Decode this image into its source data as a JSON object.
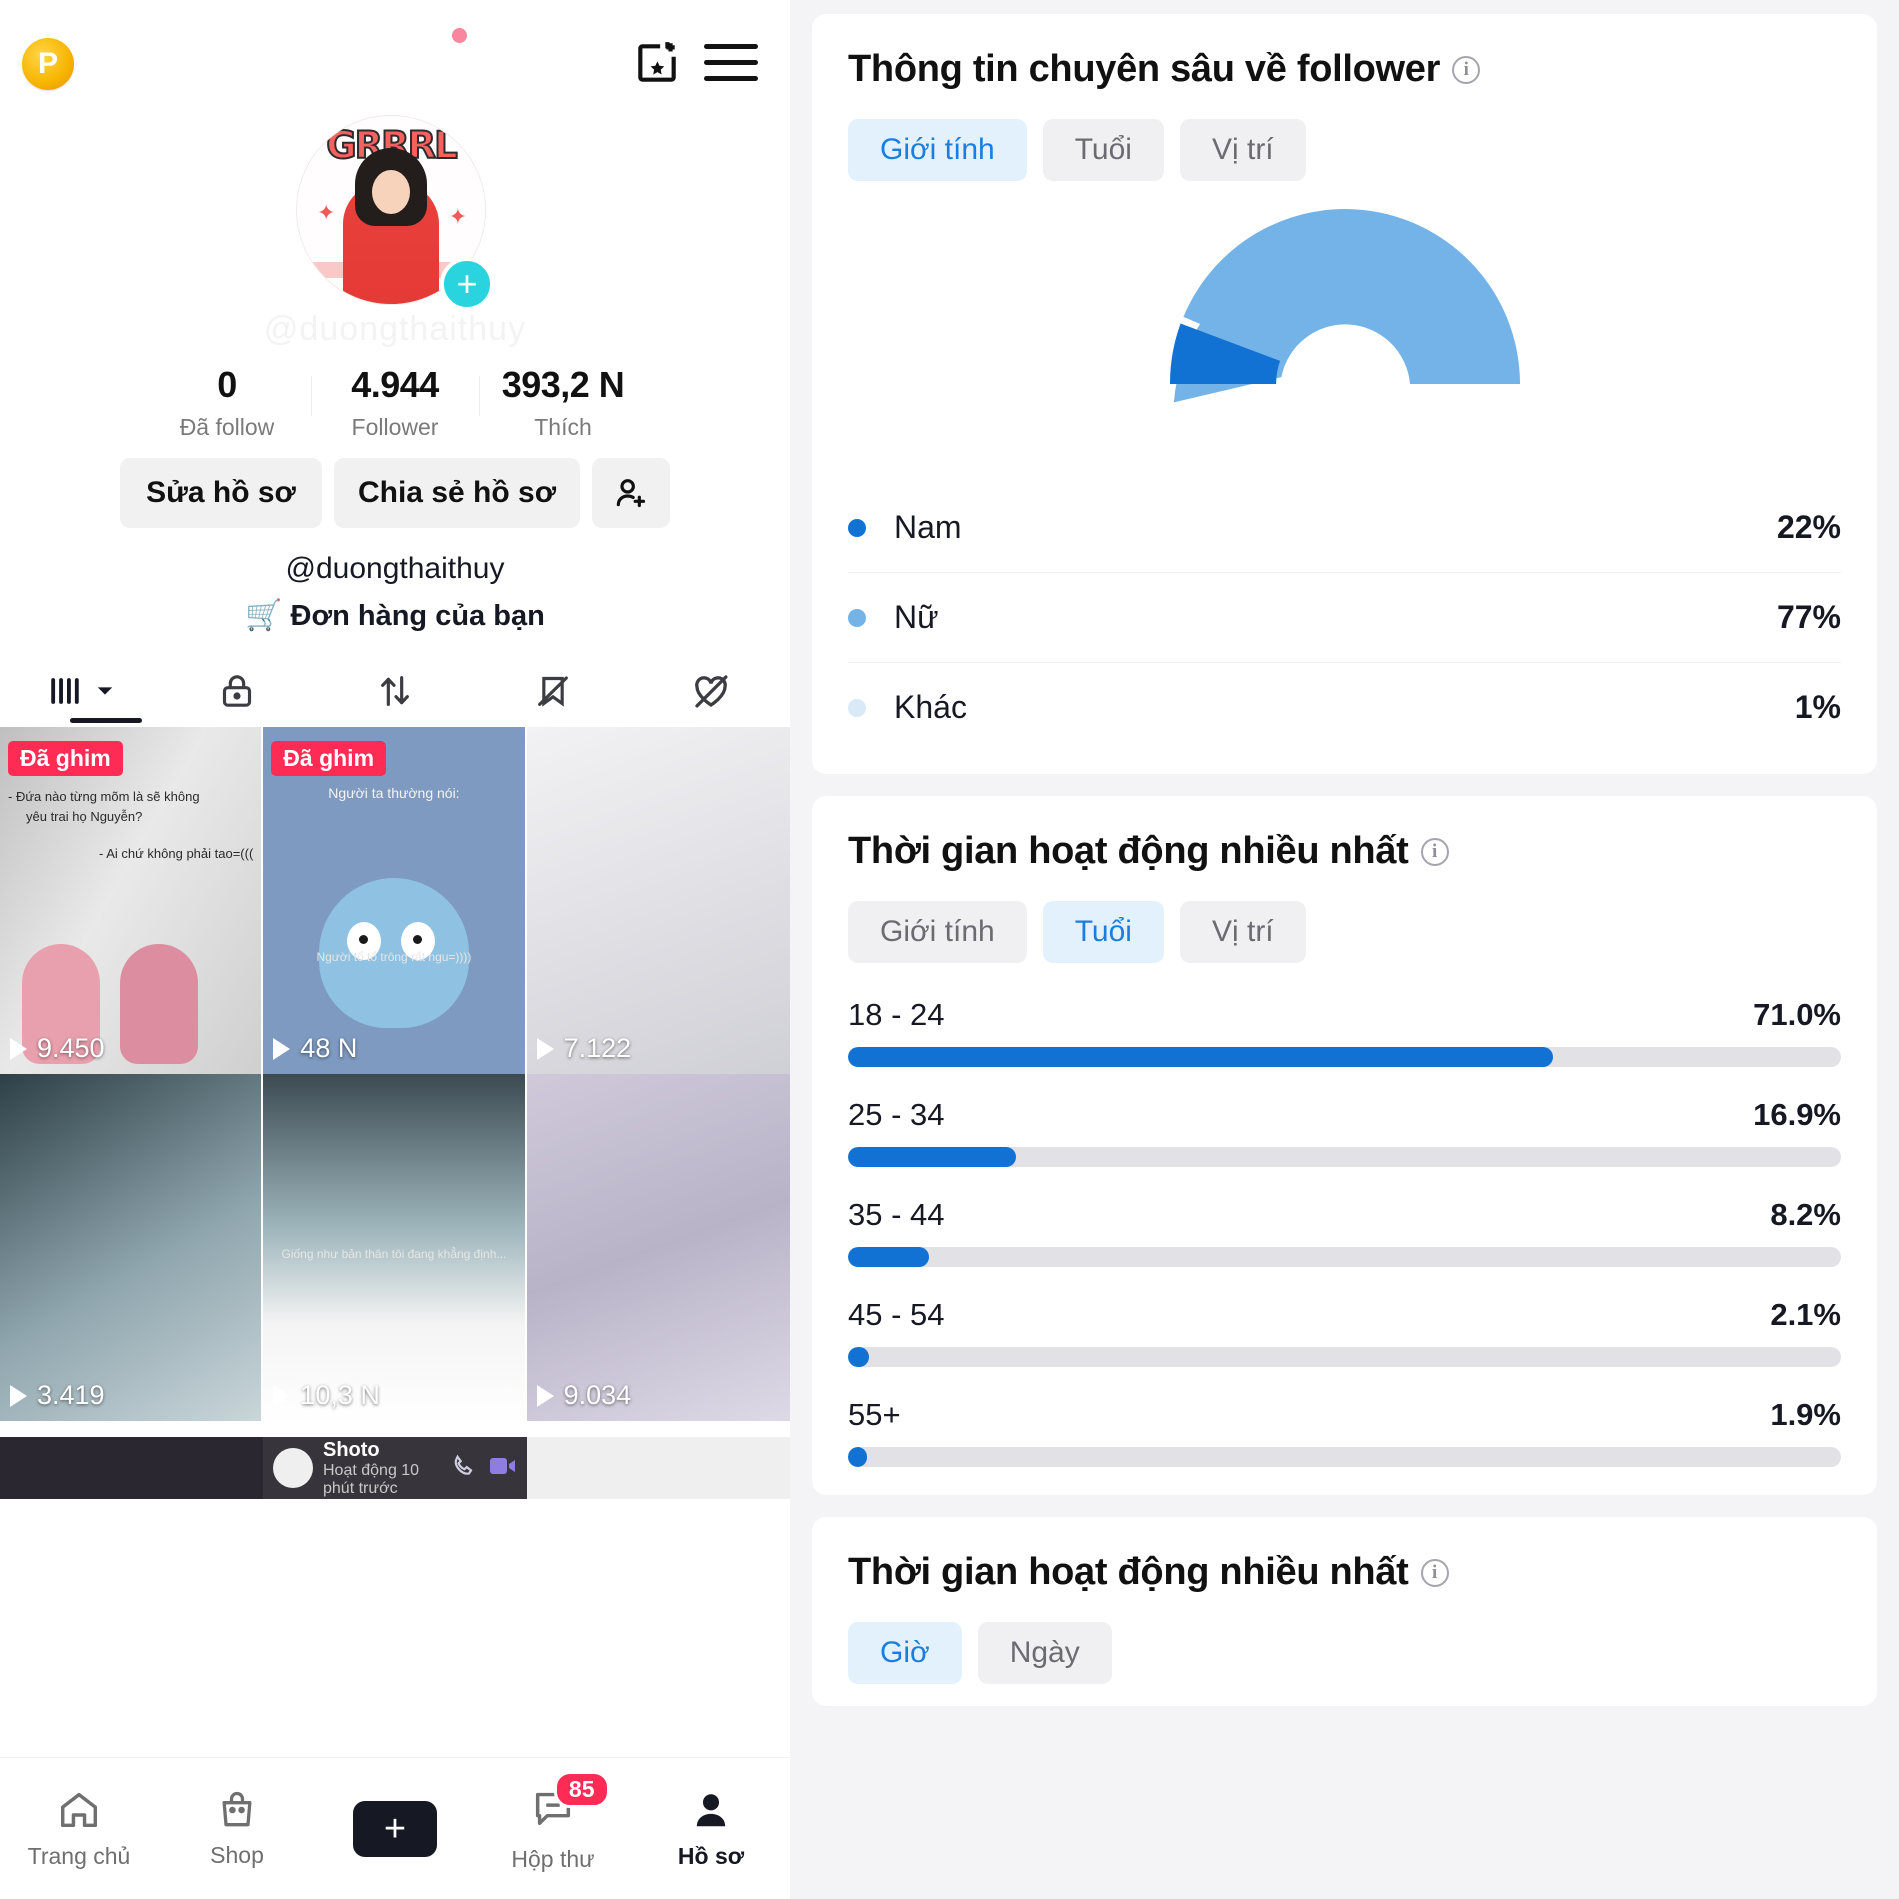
{
  "left_panel": {
    "topbar": {
      "coin_badge": "P",
      "faded_title": "",
      "calendar_icon": "calendar-star-icon",
      "menu_icon": "hamburger-menu-icon"
    },
    "profile": {
      "avatar_word": "GRRRL",
      "watermark_handle": "@duongthaithuy",
      "handle": "@duongthaithuy",
      "orders_label": "Đơn hàng của bạn",
      "plus_badge": "+"
    },
    "stats": [
      {
        "value": "0",
        "label": "Đã follow"
      },
      {
        "value": "4.944",
        "label": "Follower"
      },
      {
        "value": "393,2 N",
        "label": "Thích"
      }
    ],
    "actions": {
      "edit_label": "Sửa hồ sơ",
      "share_label": "Chia sẻ hồ sơ",
      "add_user_icon": "add-person-icon"
    },
    "content_tabs": [
      {
        "icon": "grid-posts-icon",
        "active": true
      },
      {
        "icon": "lock-private-icon",
        "active": false
      },
      {
        "icon": "repost-icon",
        "active": false
      },
      {
        "icon": "bookmark-hidden-icon",
        "active": false
      },
      {
        "icon": "heart-hidden-icon",
        "active": false
      }
    ],
    "videos": [
      {
        "pin": "Đã ghim",
        "views": "9.450",
        "caption_1": "- Đứa nào từng mõm là sẽ không",
        "caption_2": "yêu trai họ Nguyễn?",
        "caption_3": "- Ai chứ không phải tao=((("
      },
      {
        "pin": "Đã ghim",
        "views": "48 N",
        "caption_1": "Người ta thường nói:",
        "caption_2": "Người tổ tổ trông rất ngu=))))"
      },
      {
        "pin": "",
        "views": "7.122"
      },
      {
        "pin": "",
        "views": "3.419"
      },
      {
        "pin": "",
        "views": "10,3 N",
        "caption_1": "Giống như bản thân tôi đang khẳng định..."
      },
      {
        "pin": "",
        "views": "9.034"
      }
    ],
    "chat_overlay": {
      "name": "Shoto",
      "status": "Hoạt động 10 phút trước",
      "call_icon": "phone-icon",
      "video_icon": "video-camera-icon"
    },
    "bottom_nav": [
      {
        "label": "Trang chủ",
        "icon": "home-icon",
        "active": false,
        "badge": ""
      },
      {
        "label": "Shop",
        "icon": "shopping-bag-icon",
        "active": false,
        "badge": ""
      },
      {
        "label": "",
        "icon": "create-plus-icon",
        "active": false,
        "badge": ""
      },
      {
        "label": "Hộp thư",
        "icon": "inbox-message-icon",
        "active": false,
        "badge": "85"
      },
      {
        "label": "Hồ sơ",
        "icon": "person-profile-icon",
        "active": true,
        "badge": ""
      }
    ]
  },
  "right_panel": {
    "follower_insights": {
      "title": "Thông tin chuyên sâu về follower",
      "info_icon": "info-icon",
      "tabs": [
        {
          "label": "Giới tính",
          "active": true
        },
        {
          "label": "Tuổi",
          "active": false
        },
        {
          "label": "Vị trí",
          "active": false
        }
      ],
      "legend": [
        {
          "name": "Nam",
          "value": "22%",
          "color": "#1172d4"
        },
        {
          "name": "Nữ",
          "value": "77%",
          "color": "#74b3e8"
        },
        {
          "name": "Khác",
          "value": "1%",
          "color": "#d9e9f8"
        }
      ]
    },
    "most_active_age": {
      "title": "Thời gian hoạt động nhiều nhất",
      "info_icon": "info-icon",
      "tabs": [
        {
          "label": "Giới tính",
          "active": false
        },
        {
          "label": "Tuổi",
          "active": true
        },
        {
          "label": "Vị trí",
          "active": false
        }
      ],
      "rows": [
        {
          "label": "18 - 24",
          "value": "71.0%",
          "pct": 71.0
        },
        {
          "label": "25 - 34",
          "value": "16.9%",
          "pct": 16.9
        },
        {
          "label": "35 - 44",
          "value": "8.2%",
          "pct": 8.2
        },
        {
          "label": "45 - 54",
          "value": "2.1%",
          "pct": 2.1
        },
        {
          "label": "55+",
          "value": "1.9%",
          "pct": 1.9
        }
      ]
    },
    "most_active_time": {
      "title": "Thời gian hoạt động nhiều nhất",
      "info_icon": "info-icon",
      "tabs": [
        {
          "label": "Giờ",
          "active": true
        },
        {
          "label": "Ngày",
          "active": false
        }
      ]
    }
  },
  "chart_data": [
    {
      "type": "pie",
      "title": "Thông tin chuyên sâu về follower — Giới tính",
      "labels": [
        "Nam",
        "Nữ",
        "Khác"
      ],
      "values": [
        22,
        77,
        1
      ],
      "value_labels": [
        "22%",
        "77%",
        "1%"
      ],
      "colors": [
        "#1172d4",
        "#74b3e8",
        "#d9e9f8"
      ],
      "legend_position": "below",
      "note": "semi-circular donut gauge (180 degree sweep)"
    },
    {
      "type": "bar",
      "title": "Thời gian hoạt động nhiều nhất — Tuổi",
      "categories": [
        "18 - 24",
        "25 - 34",
        "35 - 44",
        "45 - 54",
        "55+"
      ],
      "values": [
        71.0,
        16.9,
        8.2,
        2.1,
        1.9
      ],
      "value_labels": [
        "71.0%",
        "16.9%",
        "8.2%",
        "2.1%",
        "1.9%"
      ],
      "xlabel": "",
      "ylabel": "",
      "xlim": [
        0,
        100
      ],
      "orientation": "horizontal",
      "grid": false,
      "bar_color": "#1172d4",
      "track_color": "#e2e2e6"
    }
  ]
}
